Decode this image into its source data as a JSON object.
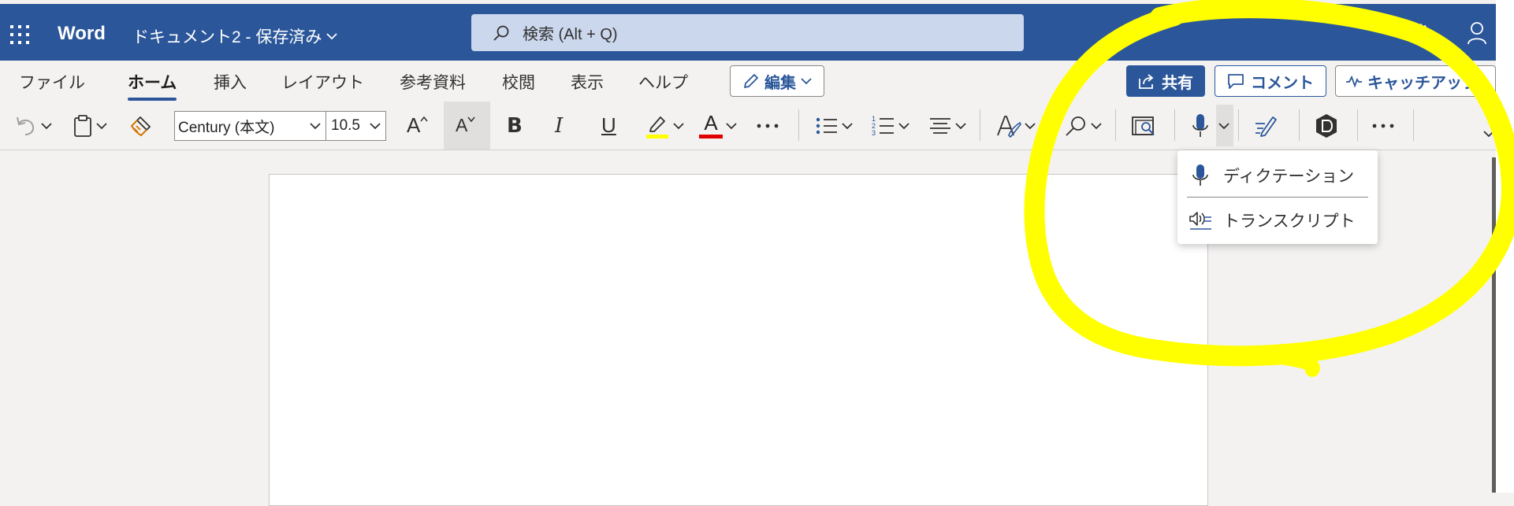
{
  "titlebar": {
    "app_name": "Word",
    "doc_title": "ドキュメント2 - 保存済み",
    "search_placeholder": "検索 (Alt + Q)"
  },
  "tabs": [
    {
      "label": "ファイル"
    },
    {
      "label": "ホーム",
      "active": true
    },
    {
      "label": "挿入"
    },
    {
      "label": "レイアウト"
    },
    {
      "label": "参考資料"
    },
    {
      "label": "校閲"
    },
    {
      "label": "表示"
    },
    {
      "label": "ヘルプ"
    }
  ],
  "actions": {
    "edit_label": "編集",
    "share_label": "共有",
    "comment_label": "コメント",
    "catchup_label": "キャッチアップ"
  },
  "ribbon": {
    "font_name": "Century (本文)",
    "font_size": "10.5",
    "grow_font_label": "A",
    "shrink_font_label": "A",
    "bold_label": "B",
    "italic_label": "I",
    "underline_label": "U",
    "font_color_label": "A",
    "highlight_color": "#ffff00",
    "font_color": "#e00000"
  },
  "dictate_menu": {
    "items": [
      {
        "label": "ディクテーション",
        "icon": "microphone-icon"
      },
      {
        "label": "トランスクリプト",
        "icon": "transcribe-icon"
      }
    ]
  },
  "colors": {
    "brand_blue": "#2b579a",
    "annotation_yellow": "#ffff00"
  }
}
